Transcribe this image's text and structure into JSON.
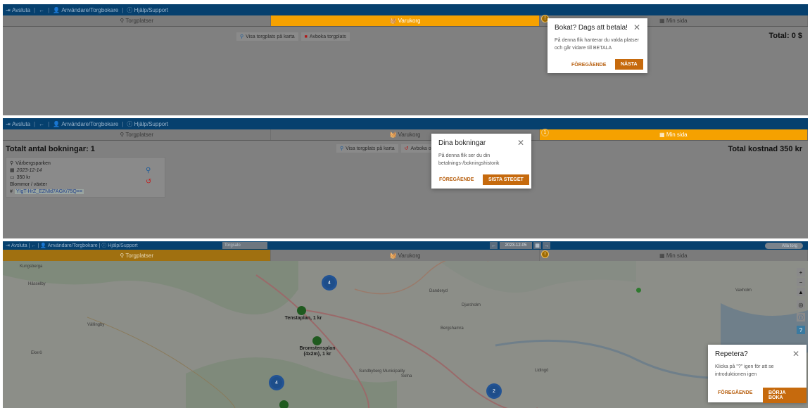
{
  "topbar": {
    "logout": "Avsluta",
    "user": "Användare/Torgbokare",
    "help": "Hjälp/Support"
  },
  "tabs": {
    "torgplatser": "Torgplatser",
    "varukorg": "Varukorg",
    "min_sida": "Min sida"
  },
  "panel1": {
    "show_on_map": "Visa torgplats på karta",
    "cancel_place": "Avboka torgplats",
    "total": "Total: 0 $",
    "popup": {
      "title": "Bokat? Dags att betala!",
      "body": "På denna flik hanterar du valda platser och går vidare till BETALA",
      "prev": "FÖREGÅENDE",
      "next": "NÄSTA"
    }
  },
  "panel2": {
    "total_bookings": "Totalt antal bokningar: 1",
    "total_cost": "Total kostnad 350 kr",
    "show_on_map": "Visa torgplats på karta",
    "cancel_and": "Avboka och å",
    "badge": "1",
    "booking": {
      "place": "Vårbergsparken",
      "date": "2023-12-14",
      "price": "350 kr",
      "category": "Blommor / växter",
      "code": "YIgT-HrZ_EZNId7AGK/75Q=="
    },
    "popup": {
      "title": "Dina bokningar",
      "body": "På denna flik ser du din betalnings-/bokningshistorik",
      "prev": "FÖREGÅENDE",
      "next": "SISTA STEGET"
    }
  },
  "panel3": {
    "select_placeholder": "Torgsalo",
    "date": "2023-12-05",
    "all_days": "Alla torg",
    "badge": "!",
    "map_labels": [
      {
        "name": "Tenstaplan, 1 kr"
      },
      {
        "name": "Bromstensplan (4x2m), 1 kr"
      }
    ],
    "clusters": [
      "4",
      "4",
      "2"
    ],
    "places": [
      "Danderyd",
      "Djursholm",
      "Sundbyberg Municipality",
      "Solna",
      "Lidingö",
      "Vaxholm",
      "Bergshamra",
      "Hässelby",
      "Ekerö",
      "Vällingby",
      "Kungsberga"
    ],
    "popup": {
      "title": "Repetera?",
      "body": "Klicka på \"?\" igen för att se introduktionen igen",
      "prev": "FÖREGÅENDE",
      "next": "BÖRJA BOKA"
    }
  },
  "colors": {
    "topbar": "#06406e",
    "active_tab": "#f5a100",
    "accent_button": "#c66a0d",
    "cluster": "#1e4e8a",
    "pin": "#1f5a1f"
  }
}
